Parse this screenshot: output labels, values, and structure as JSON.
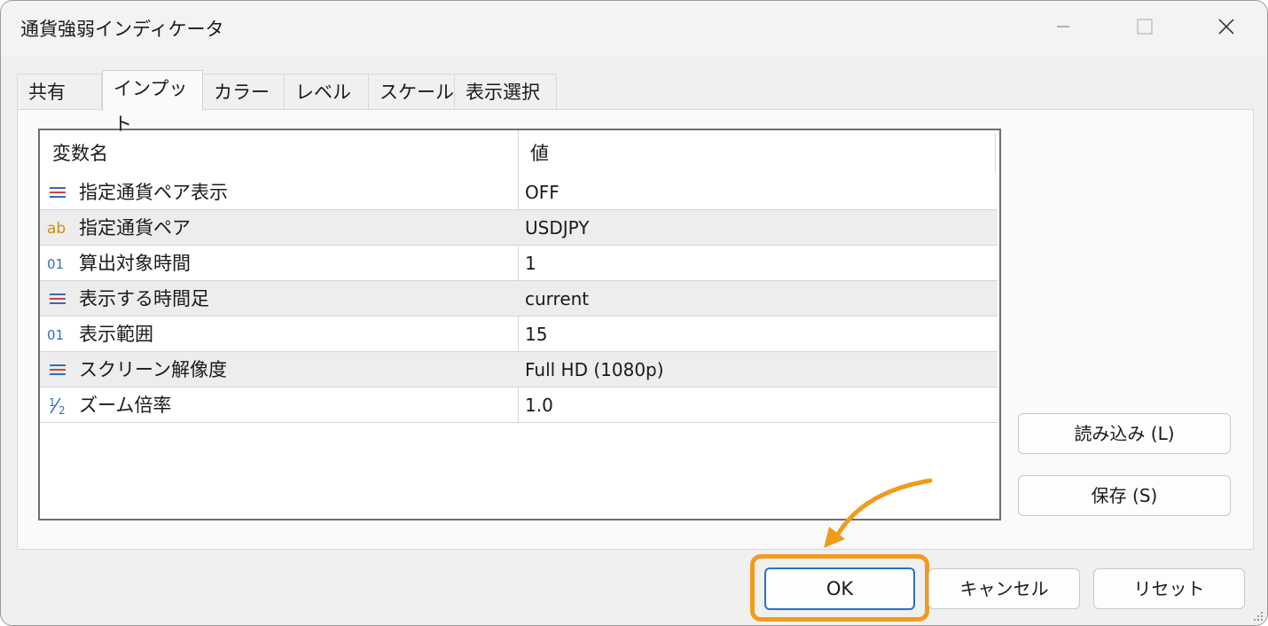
{
  "window": {
    "title": "通貨強弱インディケータ"
  },
  "tabs": [
    {
      "label": "共有"
    },
    {
      "label": "インプット"
    },
    {
      "label": "カラー"
    },
    {
      "label": "レベル"
    },
    {
      "label": "スケール"
    },
    {
      "label": "表示選択"
    }
  ],
  "table": {
    "headers": {
      "name": "変数名",
      "value": "値"
    },
    "rows": [
      {
        "icon": "list-icon",
        "name": "指定通貨ペア表示",
        "value": "OFF"
      },
      {
        "icon": "string-icon",
        "name": "指定通貨ペア",
        "value": "USDJPY"
      },
      {
        "icon": "integer-icon",
        "name": "算出対象時間",
        "value": "1"
      },
      {
        "icon": "list-icon",
        "name": "表示する時間足",
        "value": "current"
      },
      {
        "icon": "integer-icon",
        "name": "表示範囲",
        "value": "15"
      },
      {
        "icon": "list-icon",
        "name": "スクリーン解像度",
        "value": "Full HD (1080p)"
      },
      {
        "icon": "fraction-icon",
        "name": "ズーム倍率",
        "value": "1.0"
      }
    ]
  },
  "side_buttons": {
    "load": "読み込み (L)",
    "save": "保存 (S)"
  },
  "bottom_buttons": {
    "ok": "OK",
    "cancel": "キャンセル",
    "reset": "リセット"
  },
  "colors": {
    "highlight": "#f29a1e",
    "focus_border": "#2a6fc9",
    "list_icon_red": "#d94040",
    "list_icon_blue": "#2f6cc4",
    "string_icon": "#d08a1a"
  }
}
